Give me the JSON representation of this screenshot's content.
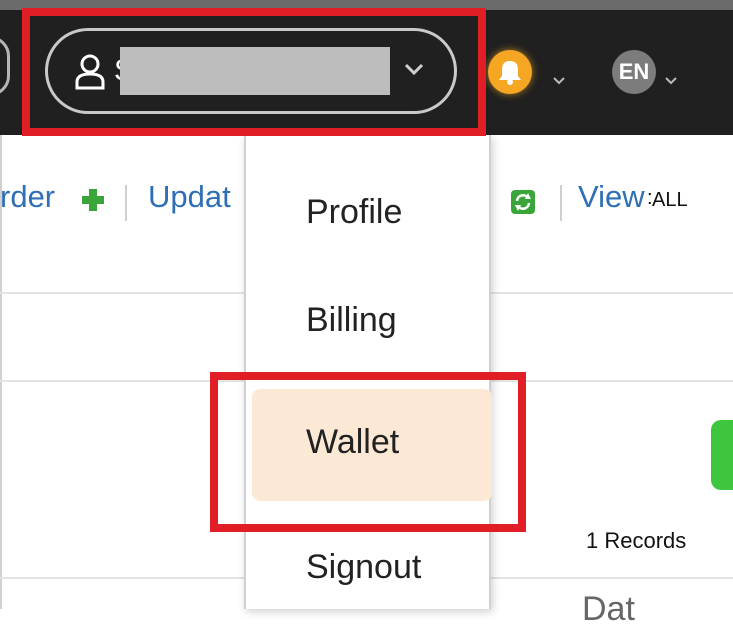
{
  "header": {
    "user_name": "S",
    "language": "EN"
  },
  "toolbar": {
    "order_label": "rder",
    "update_label": "Updat",
    "view_label": "View",
    "view_separator": ":",
    "view_value": "ALL"
  },
  "user_menu": {
    "items": [
      {
        "label": "Profile"
      },
      {
        "label": "Billing"
      },
      {
        "label": "Wallet",
        "highlighted": true
      },
      {
        "label": "Signout"
      }
    ]
  },
  "content": {
    "records_label": "1 Records",
    "partial_heading": "Dat"
  },
  "colors": {
    "header_bg": "#202020",
    "link_blue": "#2f6fb5",
    "bell_orange": "#f5a623",
    "highlight_red": "#e01e26",
    "wallet_highlight": "#fbe9d6",
    "green_button": "#3ec63e"
  }
}
